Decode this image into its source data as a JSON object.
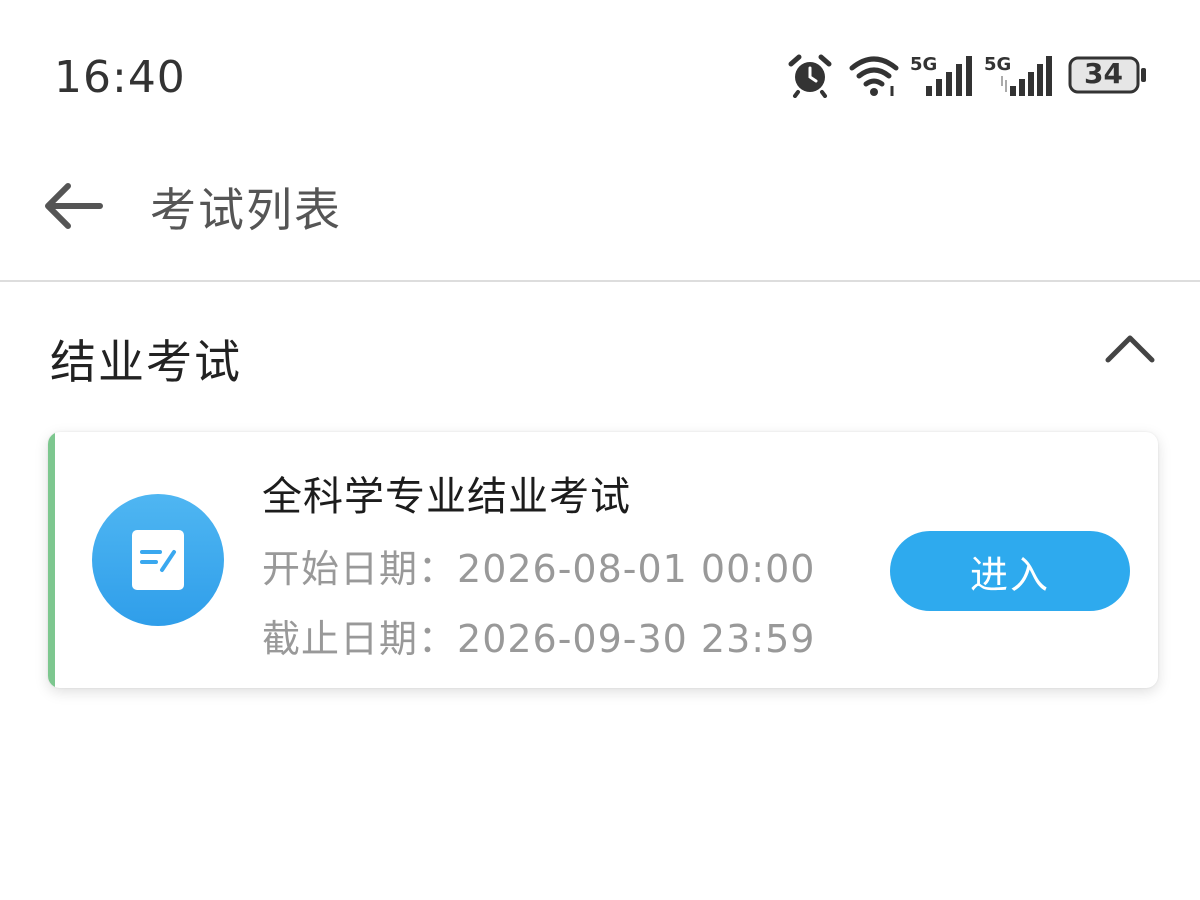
{
  "status_bar": {
    "time": "16:40",
    "network_1": "5G",
    "network_2": "5G",
    "battery": "34",
    "icons": [
      "alarm-icon",
      "wifi-icon",
      "signal-icon",
      "signal-icon",
      "battery-icon"
    ]
  },
  "nav": {
    "title": "考试列表",
    "back_icon": "arrow-left-icon"
  },
  "section": {
    "title": "结业考试",
    "collapse_icon": "chevron-up-icon"
  },
  "exam": {
    "name": "全科学专业结业考试",
    "start_label": "开始日期：",
    "start_value": "2026-08-01 00:00",
    "end_label": "截止日期：",
    "end_value": "2026-09-30 23:59",
    "enter_label": "进入",
    "icon": "document-edit-icon"
  },
  "colors": {
    "accent_green": "#7dc78f",
    "button_blue": "#2eaaee",
    "icon_blue": "#3aa8ef"
  }
}
